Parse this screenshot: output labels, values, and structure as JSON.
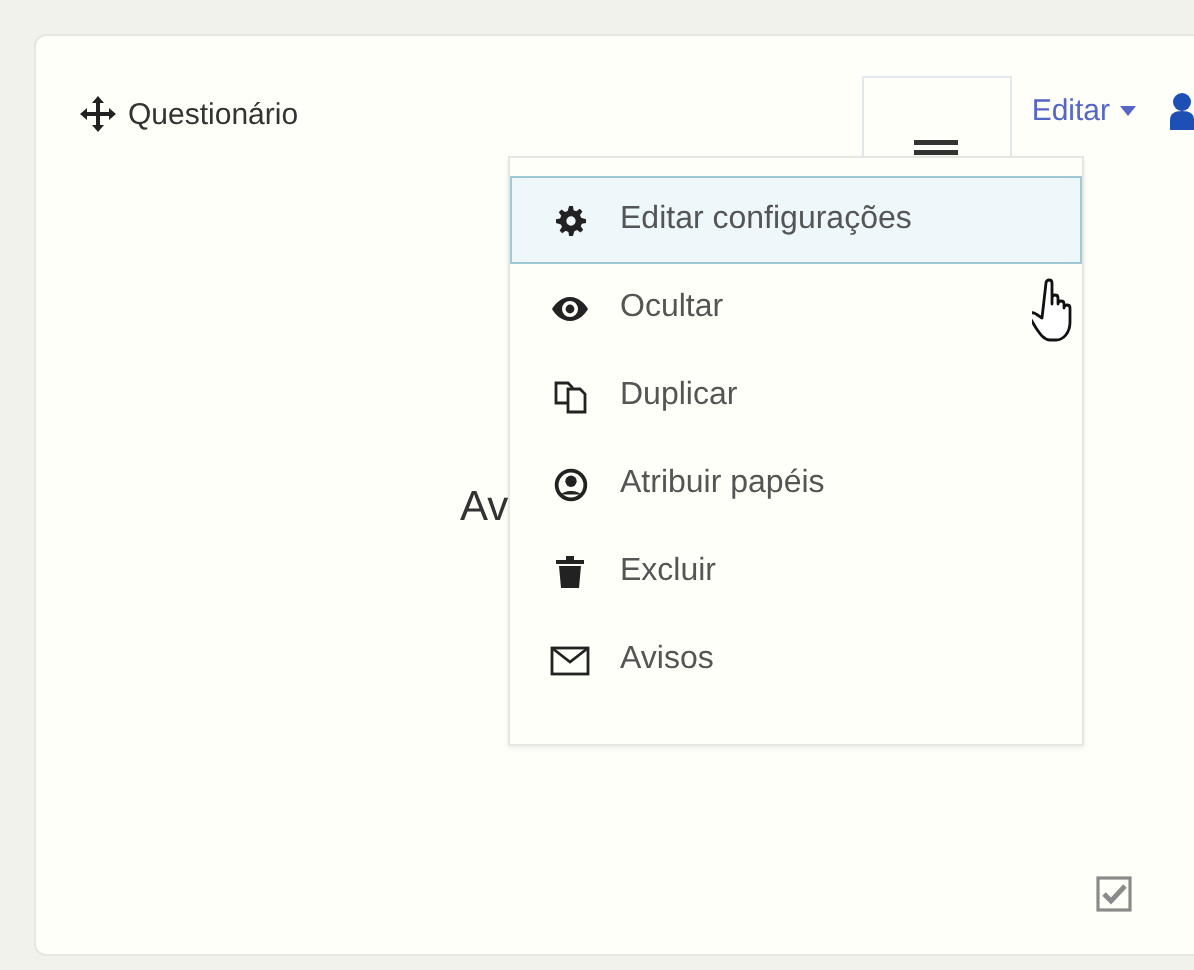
{
  "card": {
    "title": "Questionário",
    "edit_menu": {
      "label": "Editar",
      "expanded": true
    },
    "heading": "Av",
    "checkbox": {
      "checked": true
    }
  },
  "menu": [
    {
      "label": "Editar configurações",
      "selected": true
    },
    {
      "label": "Ocultar",
      "selected": false
    },
    {
      "label": "Duplicar",
      "selected": false
    },
    {
      "label": "Atribuir papéis",
      "selected": false
    },
    {
      "label": "Excluir",
      "selected": false
    },
    {
      "label": "Avisos",
      "selected": false
    }
  ]
}
